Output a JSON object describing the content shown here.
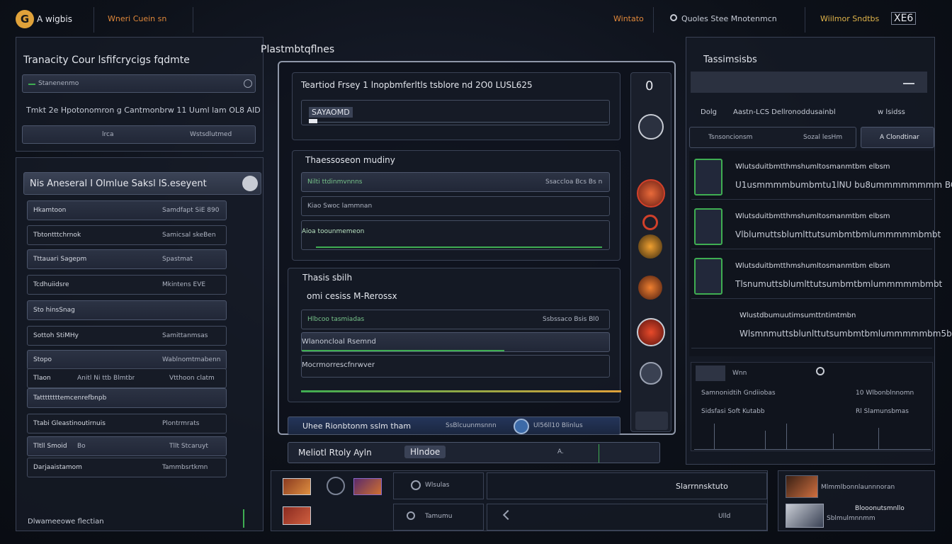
{
  "topbar": {
    "logo_text": "A wigbis",
    "nav_item": "Wneri Cuein sn",
    "nav_item_alt": "Wintato",
    "search_label": "Quoles Stee Mnotenmcn",
    "account_label": "Wiilmor Sndtbs",
    "account_code": "XE6"
  },
  "left_panel": {
    "title": "Tranacity Cour lsfifcrycigs fqdmte",
    "row1_label": "Stanenenmo",
    "info_text": "Tmkt 2e Hpotonomron g Cantmonbrw 11 Uuml lam OL8 AID",
    "row2_left": "lrca",
    "row2_right": "Wstsdlutmed"
  },
  "list_panel": {
    "title": "Nis Aneseral I Olmlue Saksl lS.eseyent",
    "items": [
      {
        "label": "Hkamtoon",
        "value": "Samdfapt SiE 890"
      },
      {
        "label": "Tbtontttchrnok",
        "value": "Samicsal skeBen"
      },
      {
        "label": "Tttauari Sagepm",
        "value": "Spastmat"
      },
      {
        "label": "Tcdhuiidsre",
        "value": "Mkintens EVE"
      },
      {
        "label": "Sto hinsSnag",
        "value": ""
      },
      {
        "label": "Sottoh StiMHy",
        "value": "Samittanmsas"
      },
      {
        "label": "Stopo",
        "value": "Wablnomtmabenn"
      },
      {
        "label": "Tlaon",
        "value": "Anitl Ni ttb Blmtbr",
        "value2": "Vtthoon clatm"
      },
      {
        "label": "Tattttttttemcenrefbnpb",
        "value": ""
      },
      {
        "label": "Ttabi Gleastinoutirnuis",
        "value": "Plontrmrats"
      },
      {
        "label": "Tltll Smoid",
        "value": "Bo",
        "value2": "Tllt Stcaruyt"
      },
      {
        "label": "Darjaaistamom",
        "value": "Tammbsrtkmn"
      }
    ],
    "footer": "Dlwameeowe flectian"
  },
  "center": {
    "title": "Plastmbtqflnes",
    "card1_title": "Teartiod Frsey 1 lnopbmferltls tsblore  nd 2O0 LUSL625",
    "card1_field": "SAYAOMD",
    "card1_counter": "0",
    "section2_title": "Thaessoseon mudiny",
    "section2_row1_left": "Nilti ttdinmvnnns",
    "section2_row1_right": "Ssaccloa Bcs Bs n",
    "section2_row2": "Kiao Swoc lammnan",
    "section2_row3": "Aioa toounmemeon",
    "section3_title": "Thasis sbilh",
    "section3_subtitle": "omi cesiss M-Rerossx",
    "section3_row1_left": "Hlbcoo tasmiadas",
    "section3_row1_right": "Ssbssaco Bsis Bl0",
    "section3_row2": "Wlanoncloal Rsemnd",
    "section3_row3": "Mocrmorrescfnrwver",
    "bottom_left": "Uhee Rionbtonm sslm tham",
    "bottom_mid": "SsBlcuunmsnnn",
    "bottom_right": "Ul56ll10 Blinlus",
    "input_label": "Meliotl Rtoly Ayln",
    "input_chip": "Hlndoe",
    "input_value": "A."
  },
  "right_panel": {
    "title": "Tassimsisbs",
    "filter_left": "Dolg",
    "filter_mid": "Aastn-LCS Dellronoddusainbl",
    "filter_right": "w lsidss",
    "tab1": "Tsnsoncionsm",
    "tab2": "Sozal lesHm",
    "tab3": "A Clondtinar",
    "rows": [
      {
        "line1": "Wlutsduitbmtthmshumltosmanmtbm elbsm",
        "line2": "U1usmmmmbumbmtu1lNU bu8ummmmmmmm BCEb"
      },
      {
        "line1": "Wlutsduitbmtthmshumltosmanmtbm elbsm",
        "line2": "Vlblumuttsblumlttutsumbmtbmlummmmmbmbt"
      },
      {
        "line1": "Wlutsduitbmtthmshumltosmanmtbm elbsm",
        "line2": "Tlsnumuttsblumlttutsumbmtbmlummmmmbmbt"
      },
      {
        "line1": "Wlustdbumuutimsumttntimtmbn",
        "line2": "Wlsmnmuttsblunlttutsumbmtbmlummmmmbm5b"
      }
    ],
    "chart_label": "Wnn",
    "chart_row1_left": "Samnonidtih Gndiiobas",
    "chart_row1_right": "10 Wlbonblnnomn",
    "chart_row2_left": "Sidsfasi Soft Kutabb",
    "chart_row2_right": "Rl Slamunsbmas"
  },
  "bottom_dock": {
    "item1": "Wlsulas",
    "item2": "Tamumu",
    "item3": "Slarrnnsktuto",
    "item4": "Ulld",
    "item5": "Mlmmlbonnlaunnnoran",
    "item6": "Blooonutsmnllo",
    "item7": "Sblmulmnnmm"
  },
  "colors": {
    "accent": "#e0883a",
    "positive": "#3fae52",
    "alert": "#d1402a"
  }
}
